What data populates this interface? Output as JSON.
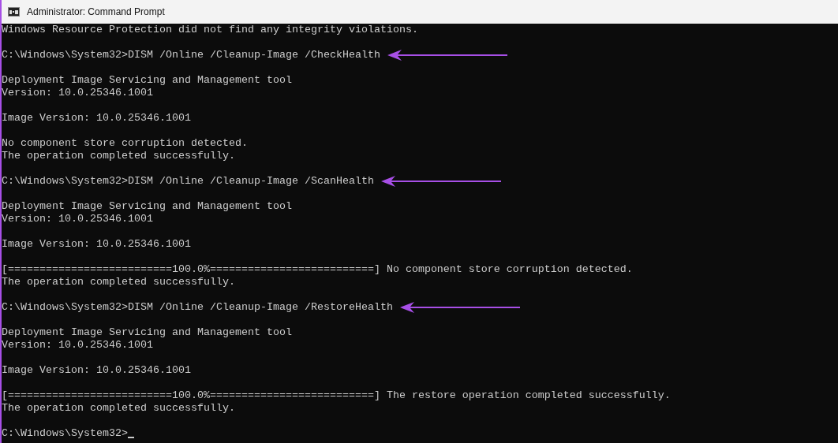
{
  "window": {
    "title": "Administrator: Command Prompt"
  },
  "console": {
    "blocks": [
      [
        {
          "text": "Windows Resource Protection did not find any integrity violations."
        }
      ],
      [
        {
          "text": "C:\\Windows\\System32>DISM /Online /Cleanup-Image /CheckHealth",
          "arrow": true
        }
      ],
      [
        {
          "text": "Deployment Image Servicing and Management tool"
        },
        {
          "text": "Version: 10.0.25346.1001"
        }
      ],
      [
        {
          "text": "Image Version: 10.0.25346.1001"
        }
      ],
      [
        {
          "text": "No component store corruption detected."
        },
        {
          "text": "The operation completed successfully."
        }
      ],
      [
        {
          "text": "C:\\Windows\\System32>DISM /Online /Cleanup-Image /ScanHealth",
          "arrow": true
        }
      ],
      [
        {
          "text": "Deployment Image Servicing and Management tool"
        },
        {
          "text": "Version: 10.0.25346.1001"
        }
      ],
      [
        {
          "text": "Image Version: 10.0.25346.1001"
        }
      ],
      [
        {
          "text": "[==========================100.0%==========================] No component store corruption detected."
        },
        {
          "text": "The operation completed successfully."
        }
      ],
      [
        {
          "text": "C:\\Windows\\System32>DISM /Online /Cleanup-Image /RestoreHealth",
          "arrow": true
        }
      ],
      [
        {
          "text": "Deployment Image Servicing and Management tool"
        },
        {
          "text": "Version: 10.0.25346.1001"
        }
      ],
      [
        {
          "text": "Image Version: 10.0.25346.1001"
        }
      ],
      [
        {
          "text": "[==========================100.0%==========================] The restore operation completed successfully."
        },
        {
          "text": "The operation completed successfully."
        }
      ],
      [
        {
          "text": "C:\\Windows\\System32>",
          "cursor": true
        }
      ]
    ]
  }
}
